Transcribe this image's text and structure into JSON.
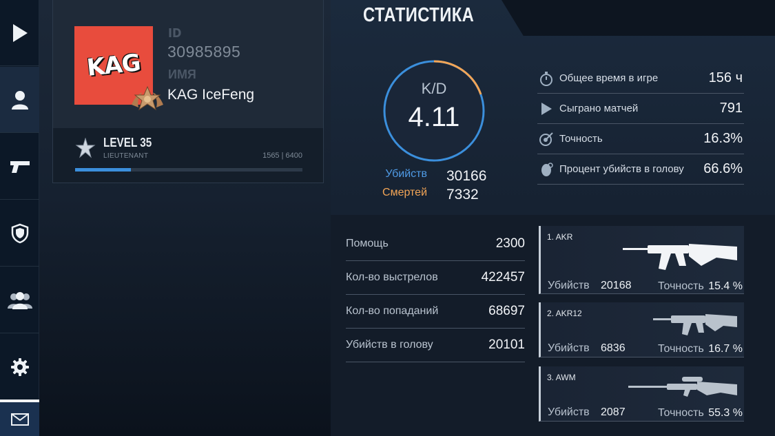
{
  "sidebar": {
    "items": [
      {
        "name": "play-icon"
      },
      {
        "name": "user-icon"
      },
      {
        "name": "pistol-icon"
      },
      {
        "name": "clan-shield-icon"
      },
      {
        "name": "friends-icon"
      },
      {
        "name": "gear-icon"
      },
      {
        "name": "mail-icon"
      }
    ]
  },
  "profile": {
    "id_label": "ID",
    "id_value": "30985895",
    "name_label": "ИМЯ",
    "name_value": "KAG IceFeng",
    "avatar_logo": "KAG",
    "level_title": "LEVEL 35",
    "rank": "LIEUTENANT",
    "xp_text": "1565 | 6400",
    "xp_progress": 0.245
  },
  "stats": {
    "title": "СТАТИСТИКА",
    "kd_label": "K/D",
    "kd_value": "4.11",
    "kills_label": "Убийств",
    "kills_value": "30166",
    "deaths_label": "Смертей",
    "deaths_value": "7332",
    "general": [
      {
        "icon": "stopwatch-icon",
        "label": "Общее время в игре",
        "value": "156 ч"
      },
      {
        "icon": "play-triangle-icon",
        "label": "Сыграно матчей",
        "value": "791"
      },
      {
        "icon": "target-icon",
        "label": "Точность",
        "value": "16.3%"
      },
      {
        "icon": "headshot-icon",
        "label": "Процент убийств в голову",
        "value": "66.6%"
      }
    ],
    "misc": [
      {
        "label": "Помощь",
        "value": "2300"
      },
      {
        "label": "Кол-во выстрелов",
        "value": "422457"
      },
      {
        "label": "Кол-во попаданий",
        "value": "68697"
      },
      {
        "label": "Убийств в голову",
        "value": "20101"
      }
    ]
  },
  "weapons": [
    {
      "name": "1. AKR",
      "kills_label": "Убийств",
      "kills": "20168",
      "acc_label": "Точность",
      "accuracy": "15.4 %",
      "icon": "akr-rifle-icon"
    },
    {
      "name": "2. AKR12",
      "kills_label": "Убийств",
      "kills": "6836",
      "acc_label": "Точность",
      "accuracy": "16.7 %",
      "icon": "akr12-rifle-icon"
    },
    {
      "name": "3. AWM",
      "kills_label": "Убийств",
      "kills": "2087",
      "acc_label": "Точность",
      "accuracy": "55.3 %",
      "icon": "awm-sniper-icon"
    }
  ],
  "colors": {
    "accent_blue": "#3b8fdc",
    "kills_blue": "#4f9be6",
    "deaths_orange": "#f3a556",
    "avatar_red": "#e84c3d"
  }
}
